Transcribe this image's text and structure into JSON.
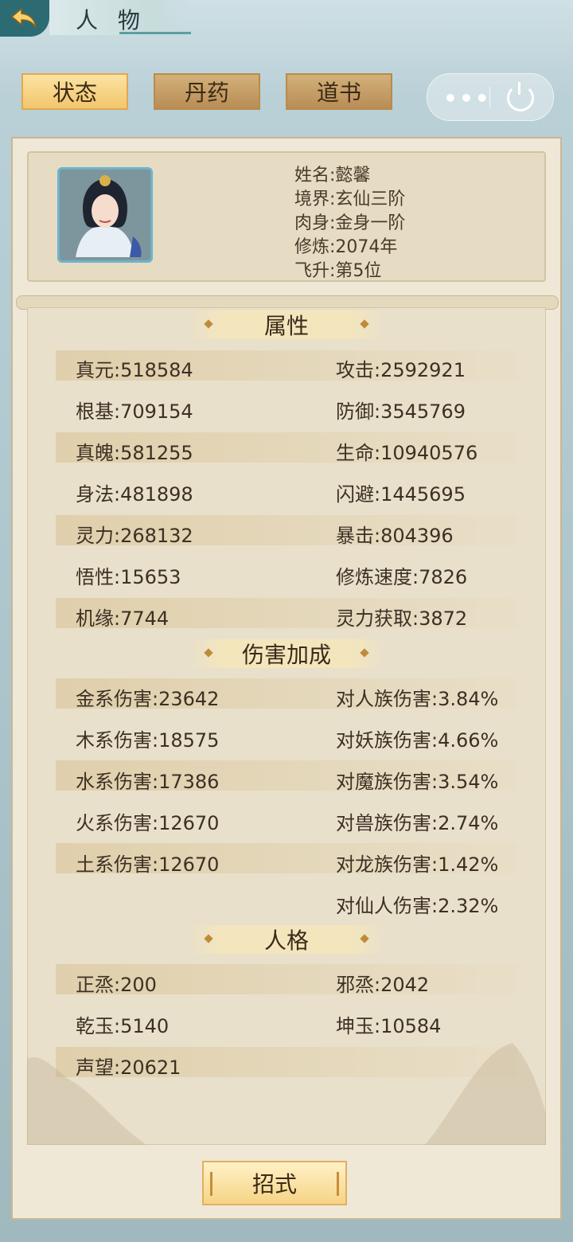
{
  "header": {
    "title": "人 物"
  },
  "tabs": [
    {
      "label": "状态",
      "active": true
    },
    {
      "label": "丹药",
      "active": false
    },
    {
      "label": "道书",
      "active": false
    }
  ],
  "capsule": {
    "more": "•••"
  },
  "profile": {
    "lines": [
      "姓名:懿馨",
      "境界:玄仙三阶",
      "肉身:金身一阶",
      "修炼:2074年",
      "飞升:第5位"
    ]
  },
  "sections": {
    "attributes": "属性",
    "damage": "伤害加成",
    "personality": "人格"
  },
  "attributes": [
    [
      "真元:518584",
      "攻击:2592921"
    ],
    [
      "根基:709154",
      "防御:3545769"
    ],
    [
      "真魄:581255",
      "生命:10940576"
    ],
    [
      "身法:481898",
      "闪避:1445695"
    ],
    [
      "灵力:268132",
      "暴击:804396"
    ],
    [
      "悟性:15653",
      "修炼速度:7826"
    ],
    [
      "机缘:7744",
      "灵力获取:3872"
    ]
  ],
  "damage": [
    [
      "金系伤害:23642",
      "对人族伤害:3.84%"
    ],
    [
      "木系伤害:18575",
      "对妖族伤害:4.66%"
    ],
    [
      "水系伤害:17386",
      "对魔族伤害:3.54%"
    ],
    [
      "火系伤害:12670",
      "对兽族伤害:2.74%"
    ],
    [
      "土系伤害:12670",
      "对龙族伤害:1.42%"
    ],
    [
      "",
      "对仙人伤害:2.32%"
    ]
  ],
  "personality": [
    [
      "正烝:200",
      "邪烝:2042"
    ],
    [
      "乾玉:5140",
      "坤玉:10584"
    ],
    [
      "声望:20621",
      ""
    ]
  ],
  "bottom_button": "招式",
  "colors": {
    "accent": "#f2c66d",
    "panel": "#f0e8d6",
    "text": "#3c3024"
  }
}
